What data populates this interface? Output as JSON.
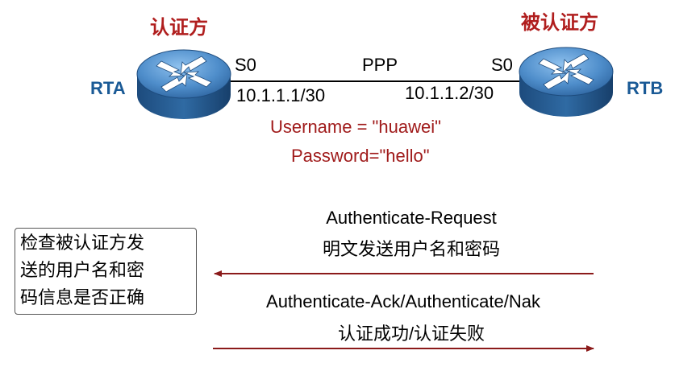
{
  "devices": {
    "authenticator": {
      "role": "认证方",
      "name": "RTA",
      "port": "S0",
      "ip": "10.1.1.1/30"
    },
    "peer": {
      "role": "被认证方",
      "name": "RTB",
      "port": "S0",
      "ip": "10.1.1.2/30"
    }
  },
  "link": {
    "protocol": "PPP"
  },
  "credentials": {
    "username": "Username = \"huawei\"",
    "password": "Password=\"hello\""
  },
  "check_box": {
    "lines": [
      "检查被认证方发",
      "送的用户名和密",
      "码信息是否正确"
    ]
  },
  "messages": {
    "request": {
      "line1": "Authenticate-Request",
      "line2": "明文发送用户名和密码"
    },
    "response": {
      "line1": "Authenticate-Ack/Authenticate/Nak",
      "line2": "认证成功/认证失败"
    }
  },
  "colors": {
    "arrow": "#8b1a1a",
    "router_body": "#2f6aa3",
    "router_top": "#5c9ad2",
    "role_text": "#b01e1e",
    "device_name": "#1a5a96"
  }
}
